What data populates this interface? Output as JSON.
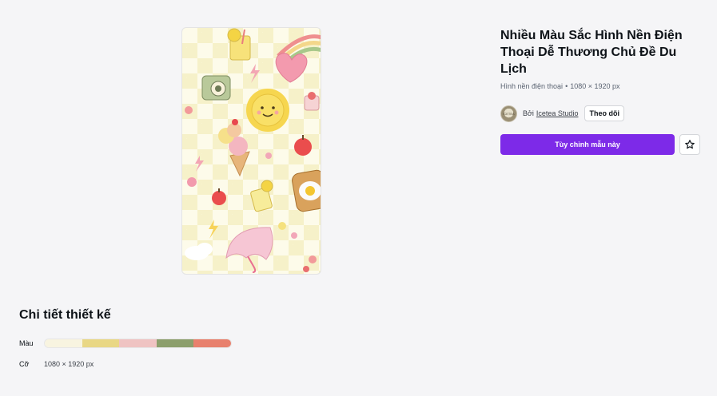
{
  "template": {
    "title": "Nhiều Màu Sắc Hình Nền Điện Thoại Dễ Thương Chủ Đề Du Lịch",
    "type": "Hình nền điện thoại",
    "separator": "•",
    "dimensions": "1080 × 1920 px"
  },
  "author": {
    "by_label": "Bởi",
    "name": "Icetea Studio",
    "avatar_text": "ICETEA",
    "follow_label": "Theo dõi"
  },
  "actions": {
    "customize_label": "Tùy chỉnh mẫu này",
    "favorite_icon": "star-icon"
  },
  "details": {
    "heading": "Chi tiết thiết kế",
    "color_label": "Màu",
    "size_label": "Cỡ",
    "size_value": "1080 × 1920 px",
    "colors": [
      "#f8f4e0",
      "#e9d784",
      "#efc3c2",
      "#8c9f6c",
      "#e8806d"
    ]
  },
  "preview_icons": [
    "lemonade-icon",
    "rainbow-heart-icon",
    "camera-icon",
    "sun-icon",
    "ice-cream-icon",
    "apple-icon",
    "toast-egg-icon",
    "umbrella-icon",
    "flower-icon",
    "lightning-icon"
  ]
}
